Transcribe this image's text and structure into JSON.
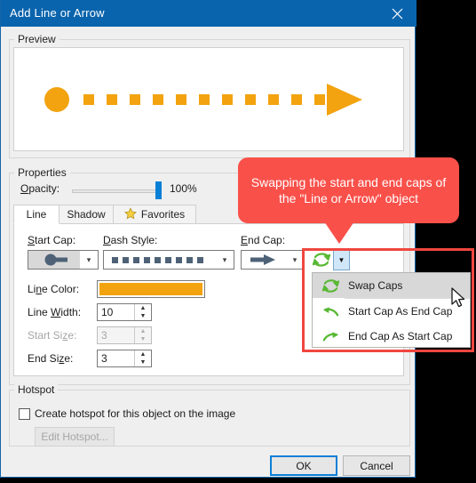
{
  "window": {
    "title": "Add Line or Arrow",
    "close_icon": "close-icon",
    "titlebar_color": "#0a64ad"
  },
  "preview": {
    "group_label": "Preview",
    "line_color": "#F2A30F",
    "start_cap_shape": "circle",
    "end_cap_shape": "arrow",
    "dash_pattern": "square-dot"
  },
  "properties": {
    "group_label": "Properties",
    "opacity": {
      "label": "Opacity:",
      "value": "100%",
      "percent": 100,
      "thumb_color": "#0a7fd6"
    },
    "tabs": [
      {
        "label": "Line",
        "active": true,
        "icon": ""
      },
      {
        "label": "Shadow",
        "active": false,
        "icon": ""
      },
      {
        "label": "Favorites",
        "active": false,
        "icon": "star-icon"
      }
    ],
    "fields": {
      "start_cap": {
        "label": "Start Cap:",
        "icon": "round-cap-icon",
        "selected": true
      },
      "dash_style": {
        "label": "Dash Style:",
        "icon": "square-dot-dash-icon"
      },
      "end_cap": {
        "label": "End Cap:",
        "icon": "arrow-cap-icon"
      },
      "line_color": {
        "label": "Line Color:",
        "value": "#F2A30F"
      },
      "line_width": {
        "label": "Line Width:",
        "value": "10",
        "enabled": true
      },
      "start_size": {
        "label": "Start Size:",
        "value": "3",
        "enabled": false
      },
      "end_size": {
        "label": "End Size:",
        "value": "3",
        "enabled": true
      }
    },
    "swap": {
      "icon": "swap-caps-icon",
      "dropdown_icon": "chevron-down-icon",
      "menu": [
        {
          "label": "Swap Caps",
          "icon": "swap-caps-icon",
          "highlighted": true
        },
        {
          "label": "Start Cap As End Cap",
          "icon": "arrow-left-icon",
          "highlighted": false
        },
        {
          "label": "End Cap As Start Cap",
          "icon": "arrow-right-icon",
          "highlighted": false
        }
      ]
    }
  },
  "callout": {
    "text": "Swapping the start and end caps of the \"Line or Arrow\" object",
    "color": "#f9504a"
  },
  "highlight": {
    "color": "#f0463f"
  },
  "hotspot": {
    "group_label": "Hotspot",
    "checkbox_label": "Create hotspot for this object on the image",
    "checked": false,
    "edit_button": "Edit Hotspot...",
    "edit_enabled": false
  },
  "footer": {
    "ok": "OK",
    "cancel": "Cancel"
  }
}
